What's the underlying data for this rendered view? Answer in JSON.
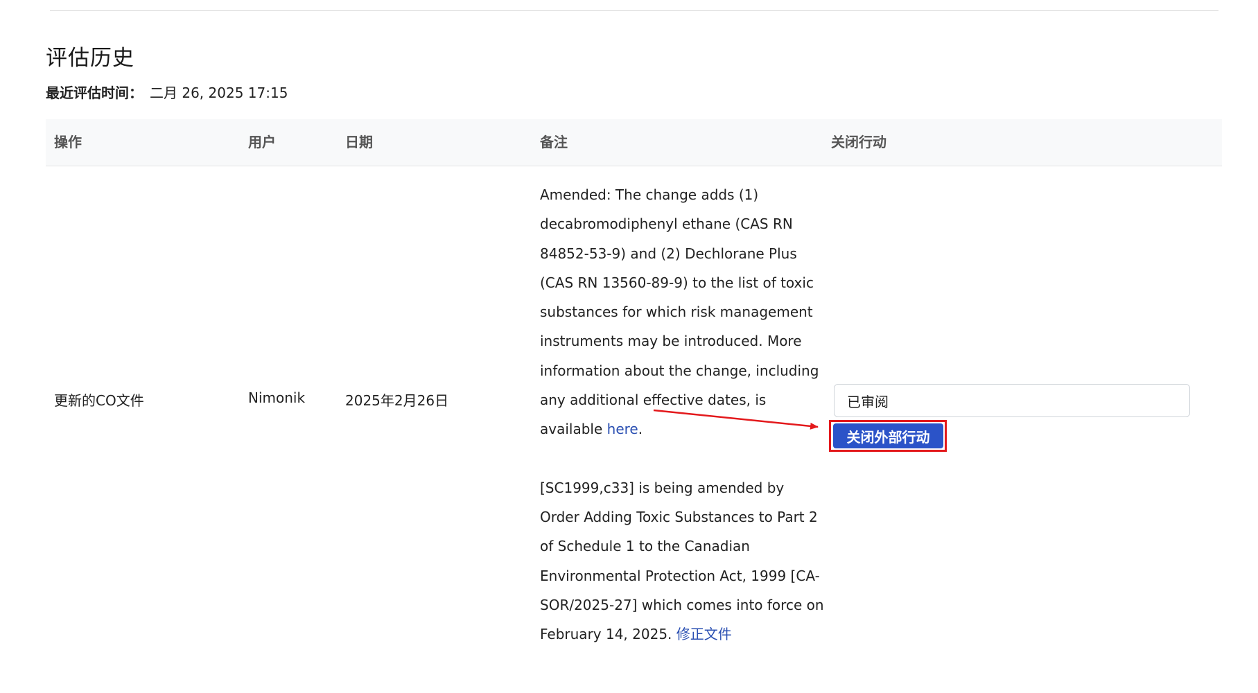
{
  "section": {
    "title": "评估历史",
    "last_assessed_label": "最近评估时间：",
    "last_assessed_value": "二月 26, 2025 17:15"
  },
  "table": {
    "headers": {
      "action": "操作",
      "user": "用户",
      "date": "日期",
      "notes": "备注",
      "close_action": "关闭行动"
    },
    "row": {
      "action": "更新的CO文件",
      "user": "Nimonik",
      "date": "2025年2月26日",
      "note_1": "Amended: The change adds (1) decabromodiphenyl ethane (CAS RN 84852-53-9) and (2) Dechlorane Plus (CAS RN 13560-89-9) to the list of toxic substances for which risk management instruments may be introduced. More information about the change, including any additional effective dates, is available",
      "note_1_link": "here",
      "note_1_end": ".",
      "note_2": "[SC1999,c33] is being amended by Order Adding Toxic Substances to Part 2 of Schedule 1 to the Canadian Environmental Protection Act, 1999 [CA-SOR/2025-27] which comes into force on February 14, 2025.",
      "note_2_link": "修正文件",
      "status_value": "已审阅",
      "close_button_label": "关闭外部行动"
    }
  },
  "colors": {
    "link": "#2a4fb2",
    "primary_button": "#2b53c8",
    "annotation_red": "#e3191c",
    "header_bg": "#f8f9fa"
  }
}
